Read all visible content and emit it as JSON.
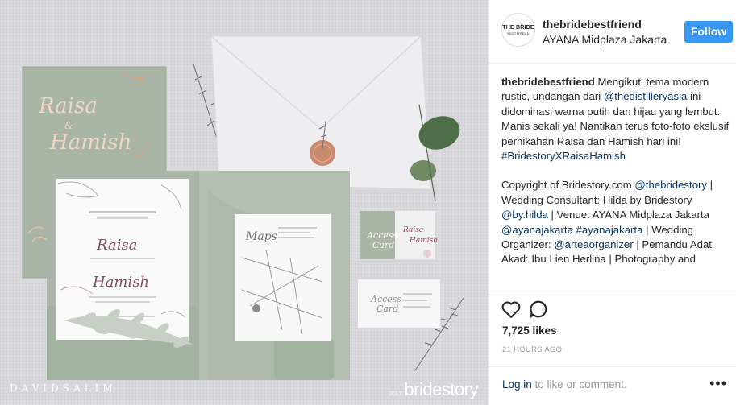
{
  "photo": {
    "card_names": [
      "Raisa",
      "&",
      "Hamish"
    ],
    "watermark_left": "DAVIDSALIM",
    "watermark_year": "2017",
    "watermark_brand": "bridestory"
  },
  "post": {
    "avatar_text": "THE BRIDE",
    "avatar_subtext": "BESTFRIEND",
    "username": "thebridebestfriend",
    "location": "AYANA Midplaza Jakarta",
    "follow_label": "Follow",
    "caption_user": "thebridebestfriend",
    "caption_p1_a": " Mengikuti tema modern rustic, undangan dari ",
    "caption_mention1": "@thedistilleryasia",
    "caption_p1_b": " ini didominasi warna putih dan hijau yang lembut. Manis sekali ya! Nantikan terus foto-foto ekslusif pernikahan Raisa dan Hamish hari ini! ",
    "caption_hashtag": "#BridestoryXRaisaHamish",
    "caption_p2_a": "Copyright of Bridestory.com ",
    "caption_mention2": "@thebridestory",
    "caption_p2_b": " | Wedding Consultant: Hilda by Bridestory ",
    "caption_mention3": "@by.hilda",
    "caption_p2_c": " | Venue: AYANA Midplaza Jakarta ",
    "caption_mention4": "@ayanajakarta",
    "caption_p2_d": " ",
    "caption_mention5": "#ayanajakarta",
    "caption_p2_e": " | Wedding Organizer: ",
    "caption_mention6": "@arteaorganizer",
    "caption_p2_f": " | Pemandu Adat Akad: Ibu Lien Herlina | Photography and",
    "likes": "7,725 likes",
    "time": "21 HOURS AGO",
    "login_link": "Log in",
    "login_rest": " to like or comment.",
    "more": "•••"
  },
  "icons": {
    "like": "heart-icon",
    "comment": "comment-icon"
  },
  "colors": {
    "accent": "#3897f0",
    "link": "#003569",
    "sage": "#9fb0a0",
    "wax": "#c98a6c",
    "muted": "#999999"
  }
}
